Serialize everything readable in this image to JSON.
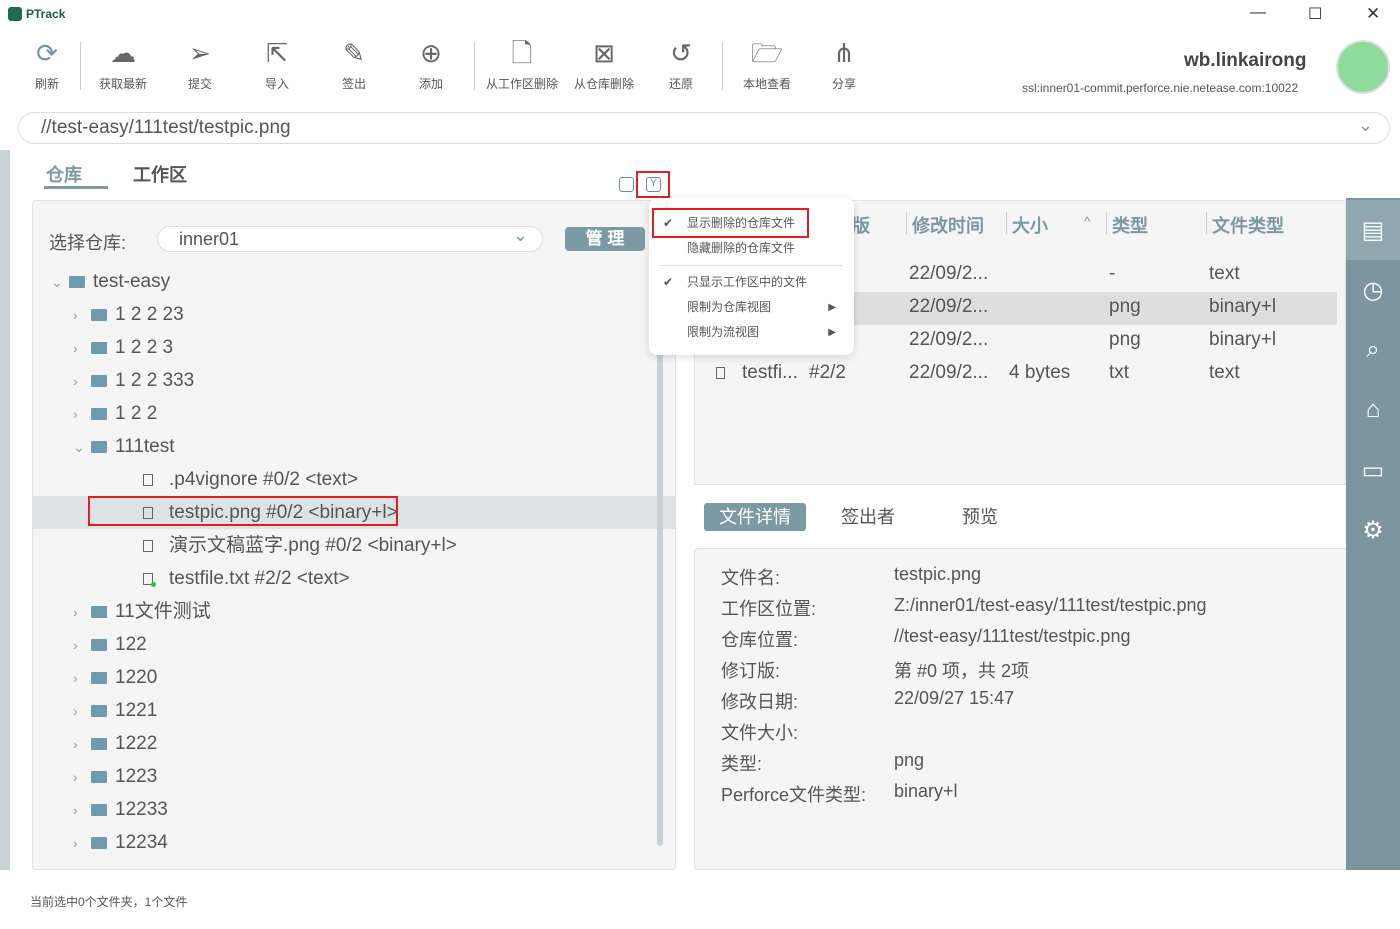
{
  "app": {
    "title": "PTrack"
  },
  "window": {
    "minimize": "—",
    "maximize": "☐",
    "close": "✕"
  },
  "toolbar": [
    {
      "label": "刷新",
      "icon": "refresh-icon",
      "glyph": "⟳"
    },
    {
      "label": "获取最新",
      "icon": "cloud-download-icon",
      "glyph": "☁"
    },
    {
      "label": "提交",
      "icon": "send-icon",
      "glyph": "➢"
    },
    {
      "label": "导入",
      "icon": "import-icon",
      "glyph": "⇱"
    },
    {
      "label": "签出",
      "icon": "checkout-edit-icon",
      "glyph": "✎"
    },
    {
      "label": "添加",
      "icon": "add-circle-icon",
      "glyph": "⊕"
    },
    {
      "label": "从工作区删除",
      "icon": "file-delete-icon",
      "glyph": "🗋"
    },
    {
      "label": "从仓库删除",
      "icon": "repo-delete-icon",
      "glyph": "⊠"
    },
    {
      "label": "还原",
      "icon": "revert-icon",
      "glyph": "↺"
    },
    {
      "label": "本地查看",
      "icon": "folder-open-icon",
      "glyph": "🗁"
    },
    {
      "label": "分享",
      "icon": "share-icon",
      "glyph": "⋔"
    }
  ],
  "user": {
    "name": "wb.linkairong",
    "server": "ssl:inner01-commit.perforce.nie.netease.com:10022"
  },
  "path": {
    "value": "//test-easy/111test/testpic.png"
  },
  "tabs": [
    {
      "label": "仓库",
      "active": true
    },
    {
      "label": "工作区",
      "active": false
    }
  ],
  "repo": {
    "label": "选择仓库:",
    "value": "inner01",
    "manage": "管 理"
  },
  "tree": [
    {
      "label": "test-easy",
      "type": "folder",
      "level": 0,
      "expanded": true
    },
    {
      "label": "1 2 2 23",
      "type": "folder",
      "level": 1
    },
    {
      "label": "1 2 2 3",
      "type": "folder",
      "level": 1
    },
    {
      "label": "1 2 2 333",
      "type": "folder",
      "level": 1
    },
    {
      "label": "1 2 2",
      "type": "folder",
      "level": 1
    },
    {
      "label": "111test",
      "type": "folder",
      "level": 1,
      "expanded": true
    },
    {
      "label": ".p4vignore  #0/2 <text>",
      "type": "file",
      "level": 2
    },
    {
      "label": "testpic.png  #0/2 <binary+l>",
      "type": "file",
      "level": 2,
      "selected": true
    },
    {
      "label": "演示文稿蓝字.png  #0/2 <binary+l>",
      "type": "file",
      "level": 2
    },
    {
      "label": "testfile.txt  #2/2 <text>",
      "type": "file",
      "level": 2,
      "status": "green"
    },
    {
      "label": "11文件测试",
      "type": "folder",
      "level": 1
    },
    {
      "label": "122",
      "type": "folder",
      "level": 1
    },
    {
      "label": "1220",
      "type": "folder",
      "level": 1
    },
    {
      "label": "1221",
      "type": "folder",
      "level": 1
    },
    {
      "label": "1222",
      "type": "folder",
      "level": 1
    },
    {
      "label": "1223",
      "type": "folder",
      "level": 1
    },
    {
      "label": "12233",
      "type": "folder",
      "level": 1
    },
    {
      "label": "12234",
      "type": "folder",
      "level": 1
    }
  ],
  "menu": [
    {
      "label": "显示删除的仓库文件",
      "checked": true
    },
    {
      "label": "隐藏删除的仓库文件",
      "checked": false
    },
    {
      "label": "只显示工作区中的文件",
      "checked": true
    },
    {
      "label": "限制为仓库视图",
      "submenu": true
    },
    {
      "label": "限制为流视图",
      "submenu": true
    }
  ],
  "table": {
    "columns": [
      "版",
      "修改时间",
      "大小",
      "类型",
      "文件类型"
    ],
    "rows": [
      {
        "name": "",
        "rev": "",
        "time": "22/09/2...",
        "size": "",
        "type": "-",
        "ftype": "text"
      },
      {
        "name": "",
        "rev": "",
        "time": "22/09/2...",
        "size": "",
        "type": "png",
        "ftype": "binary+l"
      },
      {
        "name": "",
        "rev": "",
        "time": "22/09/2...",
        "size": "",
        "type": "png",
        "ftype": "binary+l"
      },
      {
        "name": "testfi...",
        "rev": "#2/2",
        "time": "22/09/2...",
        "size": "4 bytes",
        "type": "txt",
        "ftype": "text"
      }
    ]
  },
  "detail_tabs": [
    "文件详情",
    "签出者",
    "预览"
  ],
  "details": [
    {
      "label": "文件名:",
      "value": "testpic.png"
    },
    {
      "label": "工作区位置:",
      "value": "Z:/inner01/test-easy/111test/testpic.png"
    },
    {
      "label": "仓库位置:",
      "value": "//test-easy/111test/testpic.png"
    },
    {
      "label": "修订版:",
      "value": "第 #0 项，共 2项"
    },
    {
      "label": "修改日期:",
      "value": "22/09/27 15:47"
    },
    {
      "label": "文件大小:",
      "value": ""
    },
    {
      "label": "类型:",
      "value": "png"
    },
    {
      "label": "Perforce文件类型:",
      "value": "binary+l"
    }
  ],
  "status": "当前选中0个文件夹，1个文件",
  "colors": {
    "accent": "#7b9aa3",
    "highlight": "#e02020",
    "sidebar": "#7b969e"
  }
}
